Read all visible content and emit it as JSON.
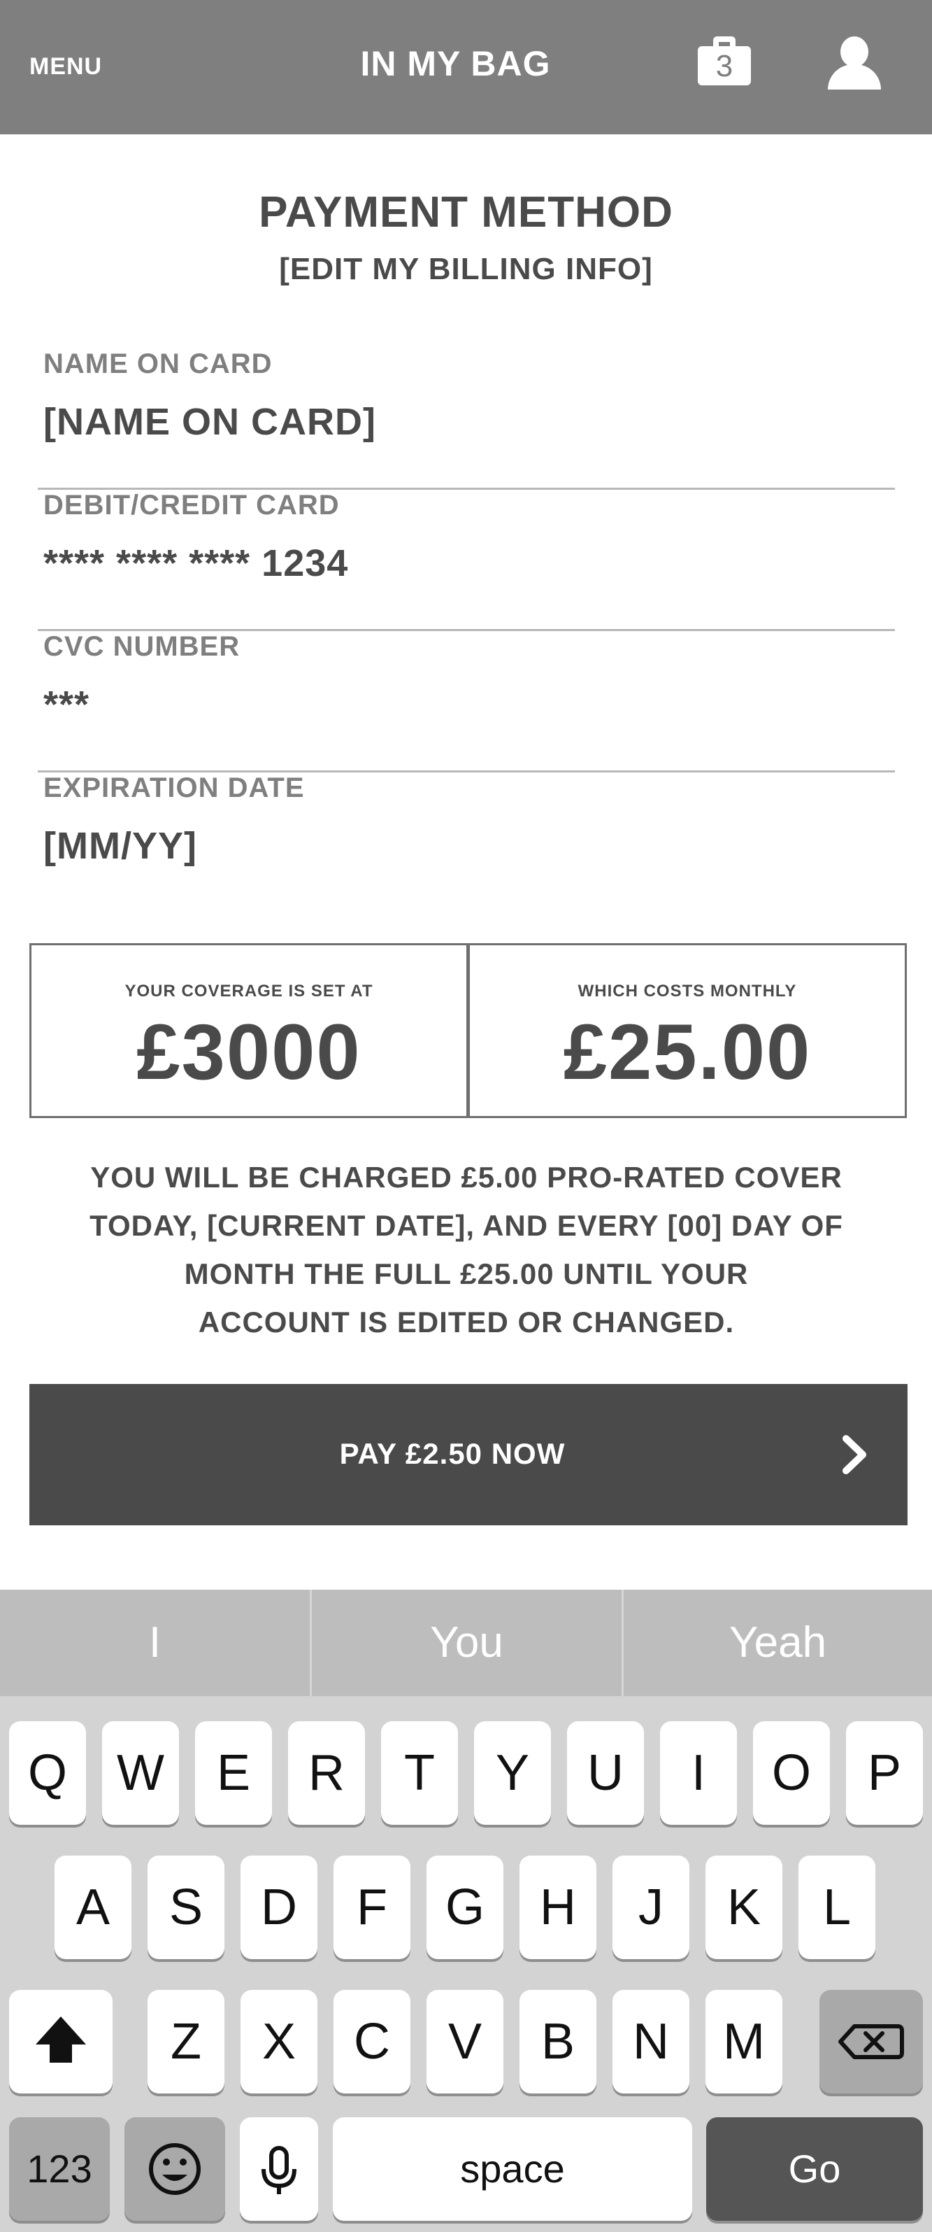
{
  "header": {
    "menu_label": "MENU",
    "title": "IN MY BAG",
    "bag_count": "3",
    "bag_icon": "shopping-bag-icon",
    "user_icon": "user-icon"
  },
  "payment": {
    "title": "PAYMENT METHOD",
    "edit_link": "[EDIT MY BILLING INFO]",
    "fields": [
      {
        "label": "NAME ON CARD",
        "value": "[NAME ON CARD]"
      },
      {
        "label": "DEBIT/CREDIT CARD",
        "value": "**** **** **** 1234"
      },
      {
        "label": "CVC NUMBER",
        "value": "***"
      },
      {
        "label": "EXPIRATION DATE",
        "value": "[MM/YY]"
      }
    ]
  },
  "coverage": {
    "left_caption": "YOUR COVERAGE IS SET AT",
    "left_amount": "£3000",
    "right_caption": "WHICH COSTS MONTHLY",
    "right_amount": "£25.00"
  },
  "notice": {
    "lines": [
      "YOU WILL BE CHARGED £5.00 PRO-RATED COVER",
      "TODAY, [CURRENT DATE], AND EVERY [00] DAY OF",
      "MONTH THE FULL £25.00 UNTIL YOUR",
      "ACCOUNT IS EDITED OR CHANGED."
    ]
  },
  "pay_button": {
    "label": "PAY £2.50 NOW",
    "icon": "chevron-right-icon"
  },
  "keyboard": {
    "suggestions": [
      "I",
      "You",
      "Yeah"
    ],
    "row1": [
      "Q",
      "W",
      "E",
      "R",
      "T",
      "Y",
      "U",
      "I",
      "O",
      "P"
    ],
    "row2": [
      "A",
      "S",
      "D",
      "F",
      "G",
      "H",
      "J",
      "K",
      "L"
    ],
    "row3": [
      "Z",
      "X",
      "C",
      "V",
      "B",
      "N",
      "M"
    ],
    "numbers_key": "123",
    "space_key": "space",
    "go_key": "Go",
    "shift_icon": "shift-icon",
    "backspace_icon": "backspace-icon",
    "emoji_icon": "emoji-icon",
    "mic_icon": "microphone-icon"
  }
}
